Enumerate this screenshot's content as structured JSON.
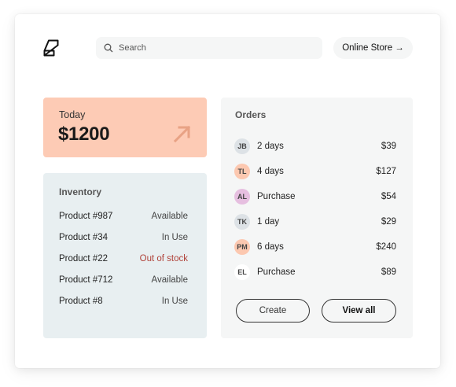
{
  "header": {
    "logo_icon": "brand-logo-icon",
    "search": {
      "placeholder": "Search",
      "value": "",
      "icon": "search-icon"
    },
    "online_store_label": "Online Store →"
  },
  "today": {
    "label": "Today",
    "value": "$1200",
    "icon": "arrow-up-right-icon",
    "color": "#fdcbb5"
  },
  "inventory": {
    "title": "Inventory",
    "color": "#e8eff1",
    "items": [
      {
        "name": "Product #987",
        "status": "Available"
      },
      {
        "name": "Product #34",
        "status": "In Use"
      },
      {
        "name": "Product #22",
        "status": "Out of stock"
      },
      {
        "name": "Product #712",
        "status": "Available"
      },
      {
        "name": "Product #8",
        "status": "In Use"
      }
    ],
    "out_of_stock_color": "#b0433a"
  },
  "orders": {
    "title": "Orders",
    "items": [
      {
        "initials": "JB",
        "desc": "2 days",
        "amount": "$39",
        "avatar_color": "#dde2e6"
      },
      {
        "initials": "TL",
        "desc": "4 days",
        "amount": "$127",
        "avatar_color": "#fcc8b0"
      },
      {
        "initials": "AL",
        "desc": "Purchase",
        "amount": "$54",
        "avatar_color": "#e6bfe0"
      },
      {
        "initials": "TK",
        "desc": "1 day",
        "amount": "$29",
        "avatar_color": "#dde2e6"
      },
      {
        "initials": "PM",
        "desc": "6 days",
        "amount": "$240",
        "avatar_color": "#fcc8b0"
      },
      {
        "initials": "EL",
        "desc": "Purchase",
        "amount": "$89",
        "avatar_color": "#ffffff"
      }
    ],
    "create_label": "Create",
    "view_all_label": "View all"
  }
}
